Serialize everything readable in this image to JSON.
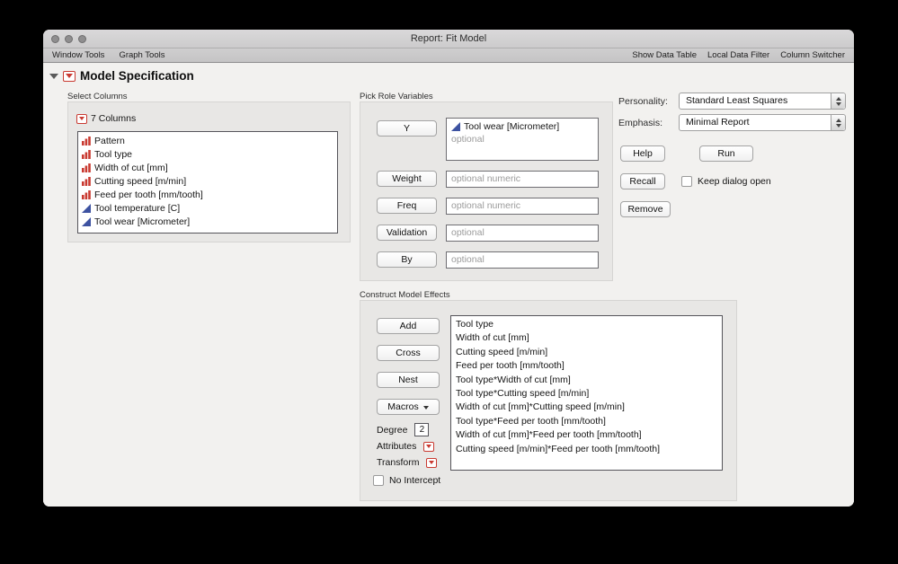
{
  "window": {
    "title": "Report: Fit Model",
    "toolbar_left": {
      "window_tools": "Window Tools",
      "graph_tools": "Graph Tools"
    },
    "toolbar_right": {
      "show_data_table": "Show Data Table",
      "local_data_filter": "Local Data Filter",
      "column_switcher": "Column Switcher"
    }
  },
  "header": {
    "title": "Model Specification"
  },
  "select_columns": {
    "label": "Select Columns",
    "count_label": "7 Columns",
    "columns": [
      {
        "name": "Pattern",
        "type": "nominal"
      },
      {
        "name": "Tool type",
        "type": "nominal"
      },
      {
        "name": "Width of cut [mm]",
        "type": "nominal"
      },
      {
        "name": "Cutting speed [m/min]",
        "type": "nominal"
      },
      {
        "name": "Feed per tooth [mm/tooth]",
        "type": "nominal"
      },
      {
        "name": "Tool temperature [C]",
        "type": "continuous"
      },
      {
        "name": "Tool wear [Micrometer]",
        "type": "continuous"
      }
    ]
  },
  "pick_roles": {
    "label": "Pick Role Variables",
    "y_button": "Y",
    "y_value": "Tool wear [Micrometer]",
    "y_placeholder": "optional",
    "weight_button": "Weight",
    "weight_placeholder": "optional numeric",
    "freq_button": "Freq",
    "freq_placeholder": "optional numeric",
    "validation_button": "Validation",
    "validation_placeholder": "optional",
    "by_button": "By",
    "by_placeholder": "optional"
  },
  "model_effects": {
    "label": "Construct Model Effects",
    "add_button": "Add",
    "cross_button": "Cross",
    "nest_button": "Nest",
    "macros_button": "Macros",
    "degree_label": "Degree",
    "degree_value": "2",
    "attributes_label": "Attributes",
    "transform_label": "Transform",
    "no_intercept_label": "No Intercept",
    "effects": [
      "Tool type",
      "Width of cut [mm]",
      "Cutting speed [m/min]",
      "Feed per tooth [mm/tooth]",
      "Tool type*Width of cut [mm]",
      "Tool type*Cutting speed [m/min]",
      "Width of cut [mm]*Cutting speed [m/min]",
      "Tool type*Feed per tooth [mm/tooth]",
      "Width of cut [mm]*Feed per tooth [mm/tooth]",
      "Cutting speed [m/min]*Feed per tooth [mm/tooth]"
    ]
  },
  "model_setup": {
    "personality_label": "Personality:",
    "personality_value": "Standard Least Squares",
    "emphasis_label": "Emphasis:",
    "emphasis_value": "Minimal Report",
    "help_button": "Help",
    "run_button": "Run",
    "recall_button": "Recall",
    "keep_dialog_label": "Keep dialog open",
    "remove_button": "Remove"
  },
  "colors": {
    "accent_red": "#c93a31",
    "continuous_blue": "#3d52a1"
  }
}
